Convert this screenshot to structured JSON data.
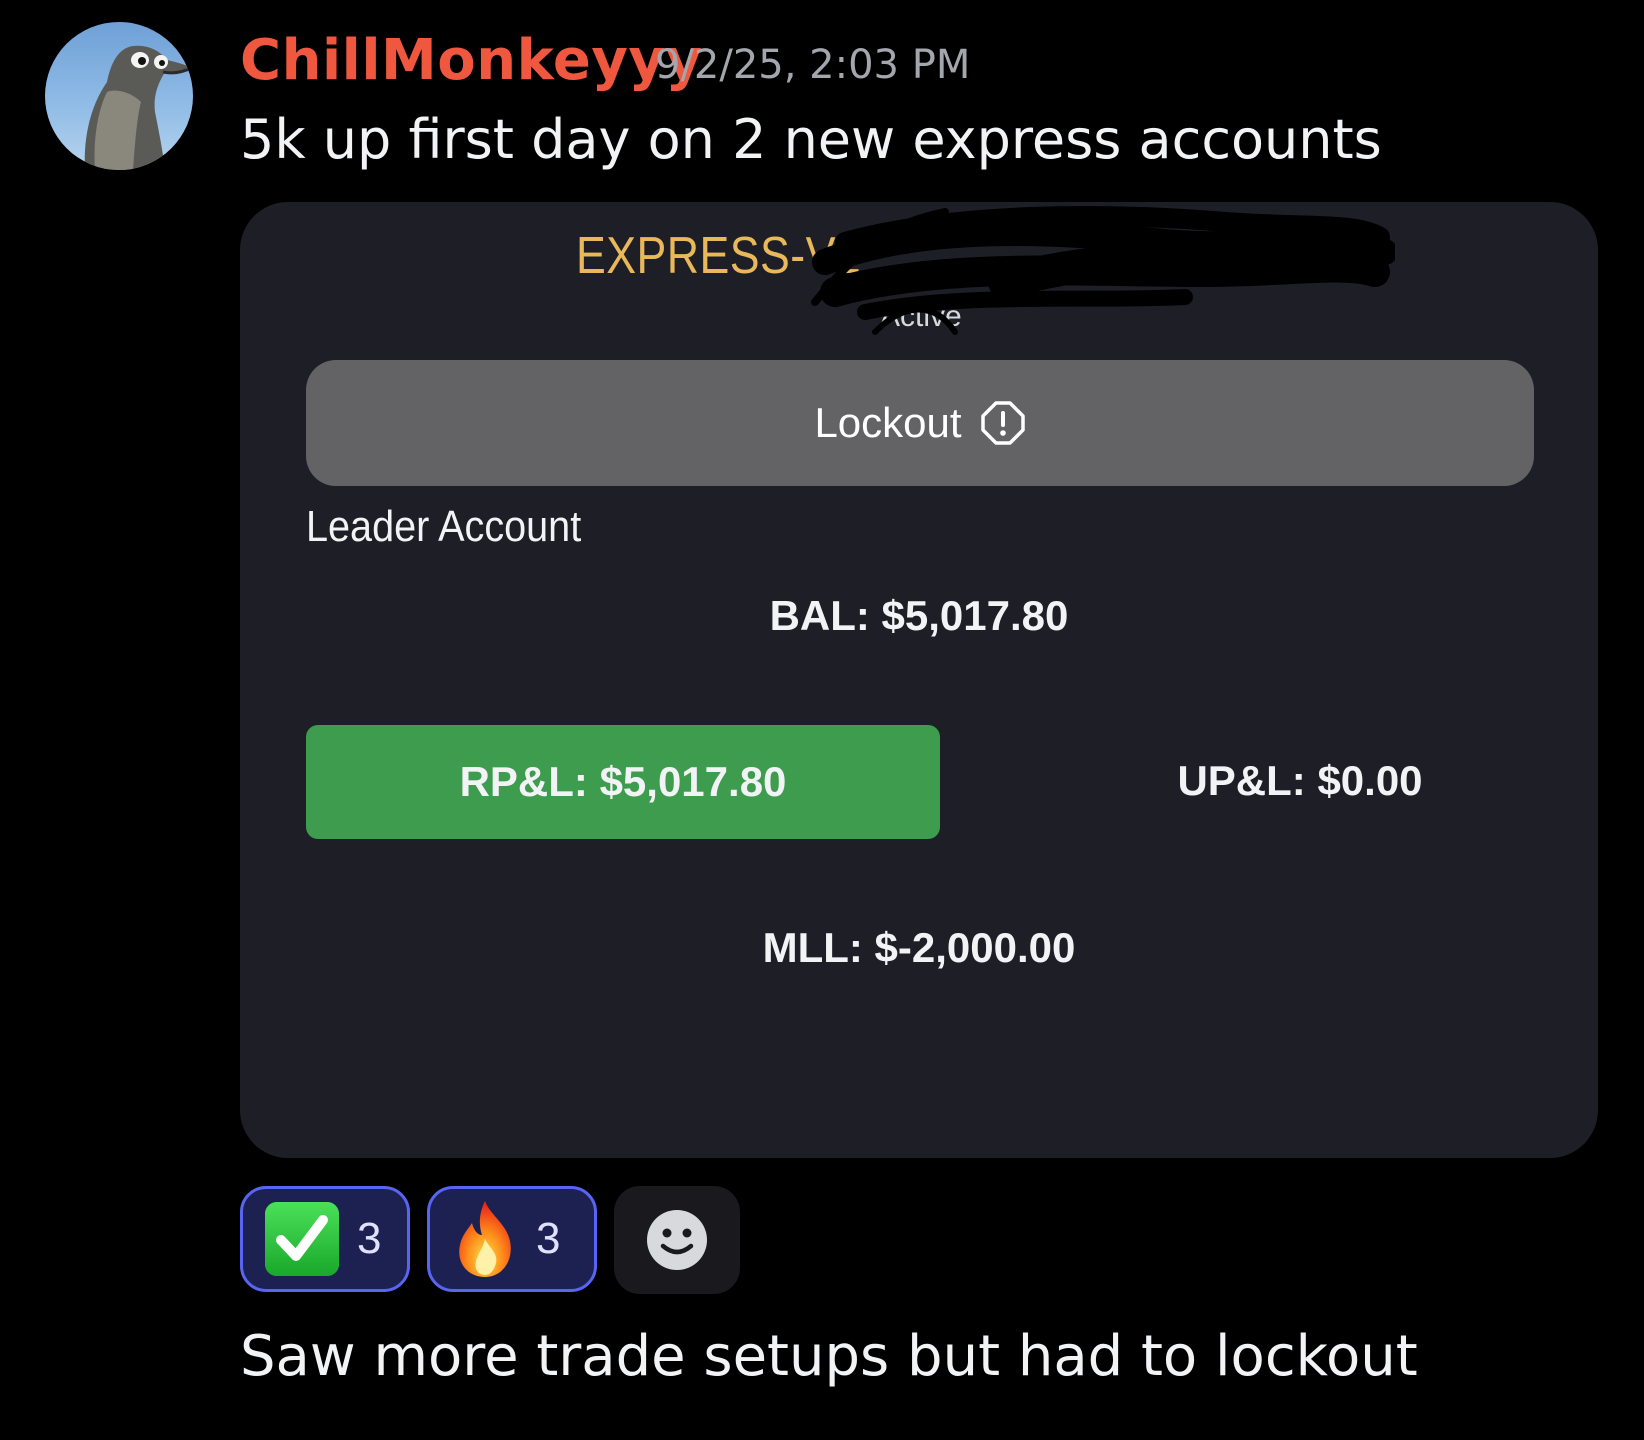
{
  "message": {
    "author": "ChillMonkeyyy",
    "timestamp": "9/2/25, 2:03 PM",
    "text": "5k up first day on 2 new express accounts",
    "followup_text": "Saw more trade setups but had to lockout"
  },
  "avatar": {
    "icon": "seagull-avatar-icon"
  },
  "card": {
    "title": "EXPRESS-V2",
    "status": "Active",
    "lockout_label": "Lockout",
    "lockout_icon": "info-circle-icon",
    "leader_label": "Leader Account",
    "bal": "BAL: $5,017.80",
    "rpl": "RP&L: $5,017.80",
    "upl": "UP&L: $0.00",
    "mll": "MLL: $-2,000.00",
    "colors": {
      "title": "#e8b85a",
      "rpl_bg": "#3e9c4f",
      "card_bg": "#1e1f26"
    }
  },
  "reactions": [
    {
      "emoji": "check-mark-emoji",
      "count": "3"
    },
    {
      "emoji": "fire-emoji",
      "count": "3"
    }
  ],
  "add_reaction_icon": "smiley-add-reaction-icon",
  "colors": {
    "username": "#f0573f",
    "reaction_border": "#5865f2"
  }
}
